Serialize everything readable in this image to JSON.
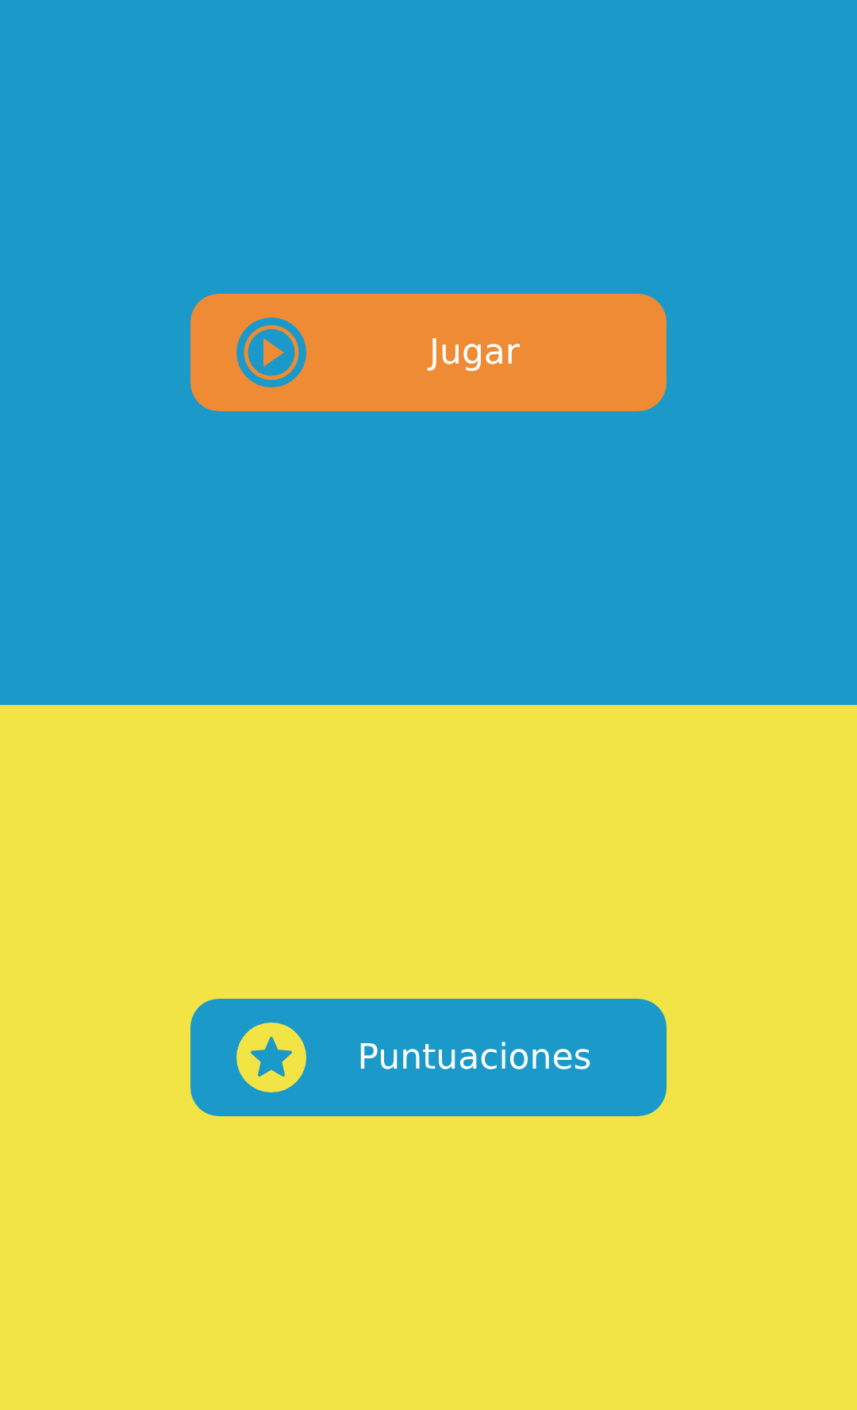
{
  "buttons": [
    {
      "kind": "play",
      "label": "Jugar"
    },
    {
      "kind": "star",
      "label": "Puntuaciones"
    }
  ]
}
